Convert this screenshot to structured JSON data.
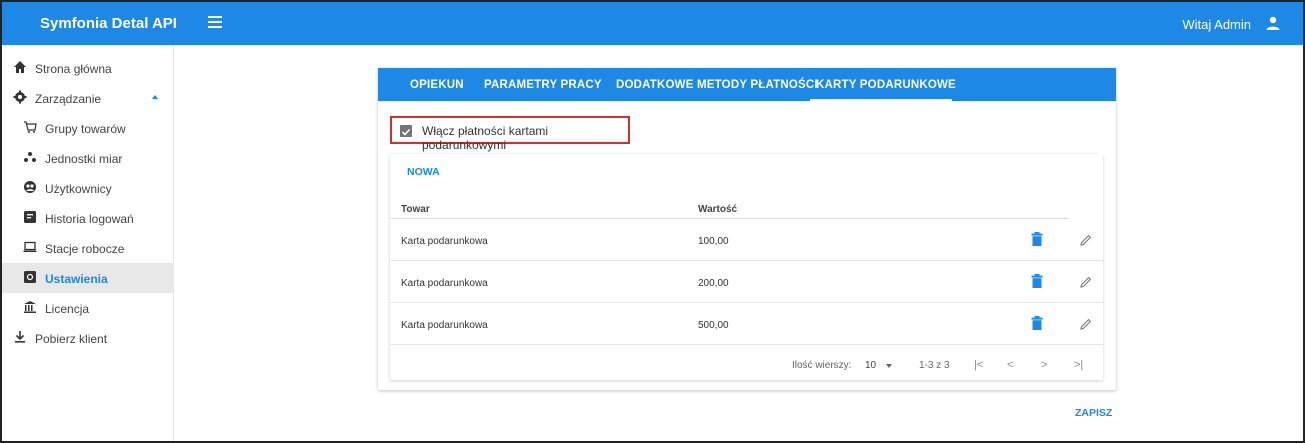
{
  "app": {
    "title": "Symfonia Detal API",
    "welcome": "Witaj Admin"
  },
  "sidebar": {
    "items": [
      {
        "label": "Strona główna",
        "icon": "home-icon"
      },
      {
        "label": "Zarządzanie",
        "icon": "gear-icon"
      },
      {
        "label": "Grupy towarów",
        "icon": "cart-icon"
      },
      {
        "label": "Jednostki miar",
        "icon": "units-icon"
      },
      {
        "label": "Użytkownicy",
        "icon": "users-icon"
      },
      {
        "label": "Historia logowań",
        "icon": "history-icon"
      },
      {
        "label": "Stacje robocze",
        "icon": "laptop-icon"
      },
      {
        "label": "Ustawienia",
        "icon": "settings-icon"
      },
      {
        "label": "Licencja",
        "icon": "bank-icon"
      },
      {
        "label": "Pobierz klient",
        "icon": "download-icon"
      }
    ]
  },
  "tabs": [
    "OPIEKUN",
    "PARAMETRY PRACY",
    "DODATKOWE METODY PŁATNOŚCI",
    "KARTY PODARUNKOWE"
  ],
  "checkbox": {
    "label": "Włącz płatności kartami podarunkowymi",
    "checked": true
  },
  "table": {
    "add_label": "NOWA",
    "columns": [
      "Towar",
      "Wartość"
    ],
    "rows": [
      {
        "towar": "Karta podarunkowa",
        "wartosc": "100,00"
      },
      {
        "towar": "Karta podarunkowa",
        "wartosc": "200,00"
      },
      {
        "towar": "Karta podarunkowa",
        "wartosc": "500,00"
      }
    ],
    "footer": {
      "rows_label": "Ilość wierszy:",
      "rows_value": "10",
      "range": "1-3 z 3"
    }
  },
  "save_label": "ZAPISZ",
  "colors": {
    "primary": "#1e88e5",
    "danger_border": "#d32f2f"
  }
}
